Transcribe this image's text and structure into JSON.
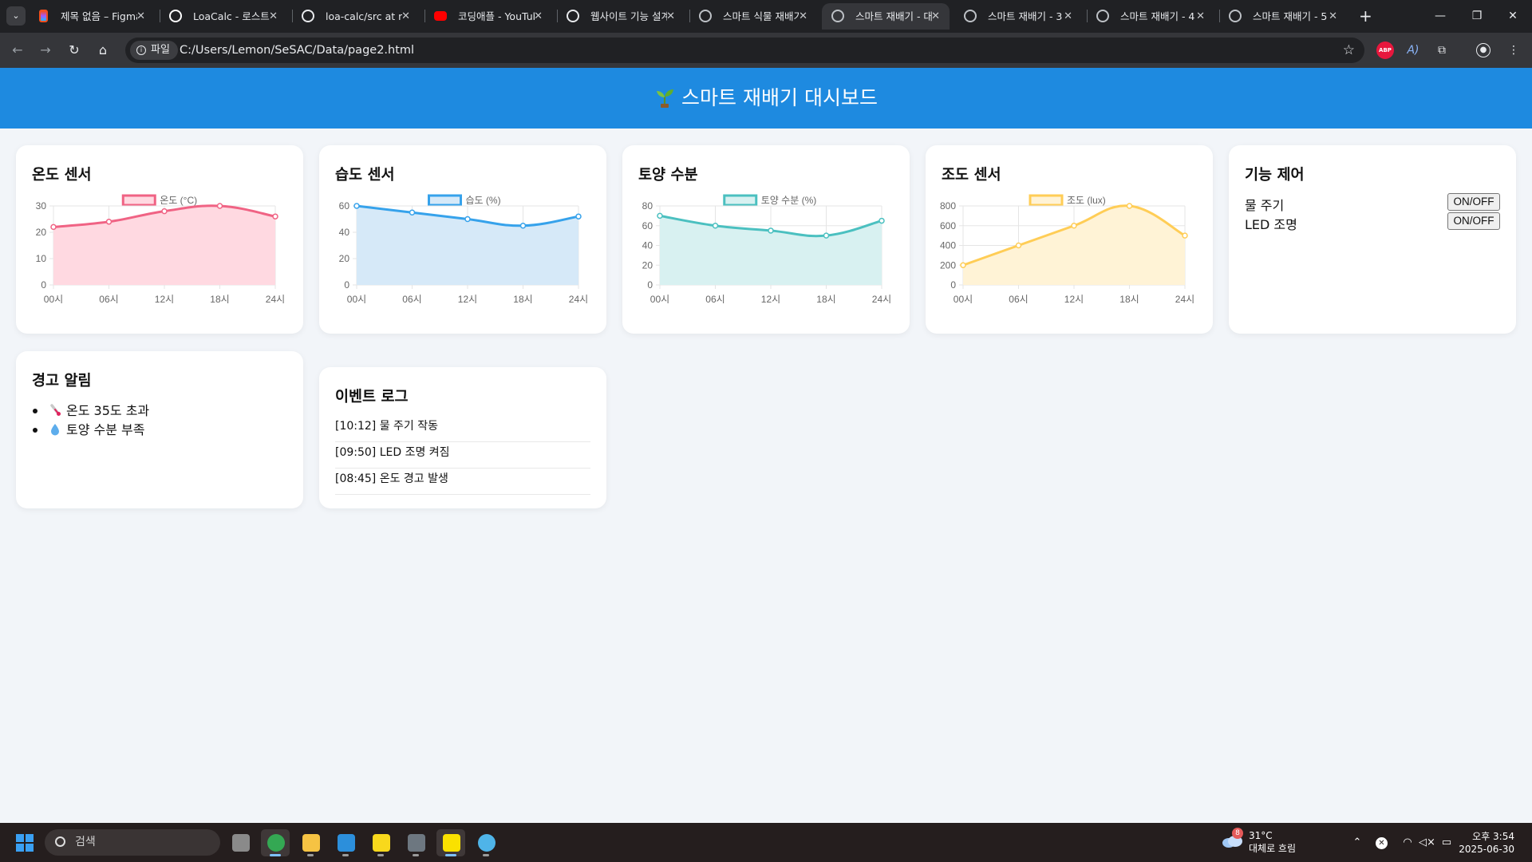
{
  "browser": {
    "tabs": [
      {
        "title": "제목 없음 – Figma",
        "icon": "figma-icon",
        "active": false
      },
      {
        "title": "LoaCalc - 로스트아크",
        "icon": "loacalc-icon",
        "active": false
      },
      {
        "title": "loa-calc/src at main",
        "icon": "github-icon",
        "active": false
      },
      {
        "title": "코딩애플 - YouTube",
        "icon": "youtube-icon",
        "active": false
      },
      {
        "title": "웹사이트 기능 설계",
        "icon": "chatgpt-icon",
        "active": false
      },
      {
        "title": "스마트 식물 재배기",
        "icon": "globe-icon",
        "active": false
      },
      {
        "title": "스마트 재배기 - 대시",
        "icon": "globe-icon",
        "active": true
      },
      {
        "title": "스마트 재배기 - 3",
        "icon": "globe-icon",
        "active": false
      },
      {
        "title": "스마트 재배기 - 4",
        "icon": "globe-icon",
        "active": false
      },
      {
        "title": "스마트 재배기 - 5",
        "icon": "globe-icon",
        "active": false
      }
    ],
    "site_chip": "파일",
    "url": "C:/Users/Lemon/SeSAC/Data/page2.html"
  },
  "page": {
    "title": "스마트 재배기 대시보드",
    "title_icon": "seedling-icon"
  },
  "sensors": [
    {
      "key": "temp",
      "title": "온도 센서",
      "chart_data": {
        "type": "area",
        "legend": "온도 (°C)",
        "categories": [
          "00시",
          "06시",
          "12시",
          "18시",
          "24시"
        ],
        "values": [
          22,
          24,
          28,
          30,
          26
        ],
        "yticks": [
          0,
          10,
          20,
          30
        ],
        "ylim": [
          0,
          30
        ],
        "color": "#f06384",
        "fill": "#ffd9e1"
      }
    },
    {
      "key": "humidity",
      "title": "습도 센서",
      "chart_data": {
        "type": "area",
        "legend": "습도 (%)",
        "categories": [
          "00시",
          "06시",
          "12시",
          "18시",
          "24시"
        ],
        "values": [
          60,
          55,
          50,
          45,
          52
        ],
        "yticks": [
          0,
          20,
          40,
          60
        ],
        "ylim": [
          0,
          60
        ],
        "color": "#36a2eb",
        "fill": "#d6e9f8"
      }
    },
    {
      "key": "soil",
      "title": "토양 수분",
      "chart_data": {
        "type": "area",
        "legend": "토양 수분 (%)",
        "categories": [
          "00시",
          "06시",
          "12시",
          "18시",
          "24시"
        ],
        "values": [
          70,
          60,
          55,
          50,
          65
        ],
        "yticks": [
          0,
          20,
          40,
          60,
          80
        ],
        "ylim": [
          0,
          80
        ],
        "color": "#4bc0c0",
        "fill": "#d8f1f1"
      }
    },
    {
      "key": "light",
      "title": "조도 센서",
      "chart_data": {
        "type": "area",
        "legend": "조도 (lux)",
        "categories": [
          "00시",
          "06시",
          "12시",
          "18시",
          "24시"
        ],
        "values": [
          200,
          400,
          600,
          800,
          500
        ],
        "yticks": [
          0,
          200,
          400,
          600,
          800
        ],
        "ylim": [
          0,
          800
        ],
        "color": "#ffcd56",
        "fill": "#fff3d6"
      }
    }
  ],
  "controls": {
    "title": "기능 제어",
    "items": [
      {
        "label": "물 주기",
        "button": "ON/OFF"
      },
      {
        "label": "LED 조명",
        "button": "ON/OFF"
      }
    ]
  },
  "alerts": {
    "title": "경고 알림",
    "items": [
      {
        "icon": "thermometer-icon",
        "text": "온도 35도 초과"
      },
      {
        "icon": "droplet-icon",
        "text": "토양 수분 부족"
      }
    ]
  },
  "event_log": {
    "title": "이벤트 로그",
    "items": [
      "[10:12] 물 주기 작동",
      "[09:50] LED 조명 켜짐",
      "[08:45] 온도 경고 발생"
    ]
  },
  "taskbar": {
    "search_placeholder": "검색",
    "weather": {
      "badge": "8",
      "temp": "31°C",
      "desc": "대체로 흐림"
    },
    "time": "오후 3:54",
    "date": "2025-06-30",
    "apps": [
      "file-explorer-icon",
      "chrome-icon",
      "folder-icon",
      "vscode-icon",
      "sticky-notes-icon",
      "calculator-icon",
      "kakaotalk-icon",
      "paint-icon"
    ]
  }
}
